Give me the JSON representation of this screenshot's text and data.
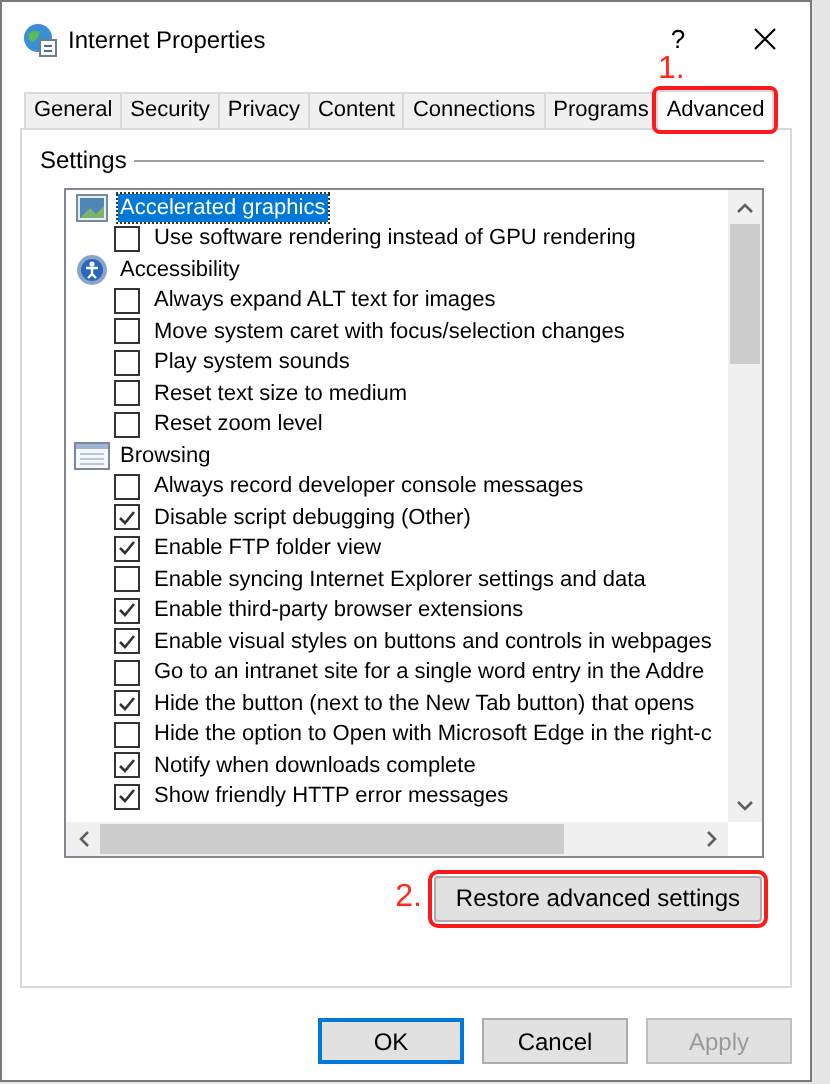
{
  "window": {
    "title": "Internet Properties",
    "help": "?"
  },
  "tabs": [
    {
      "label": "General",
      "selected": false
    },
    {
      "label": "Security",
      "selected": false
    },
    {
      "label": "Privacy",
      "selected": false
    },
    {
      "label": "Content",
      "selected": false
    },
    {
      "label": "Connections",
      "selected": false
    },
    {
      "label": "Programs",
      "selected": false
    },
    {
      "label": "Advanced",
      "selected": true,
      "step": "1."
    }
  ],
  "settings": {
    "title": "Settings",
    "tree": [
      {
        "label": "Accelerated graphics",
        "selected": true,
        "children": [
          {
            "label": "Use software rendering instead of GPU rendering",
            "checked": false,
            "selected": false
          }
        ]
      },
      {
        "label": "Accessibility",
        "selected": false,
        "children": [
          {
            "label": "Always expand ALT text for images",
            "checked": false,
            "selected": false
          },
          {
            "label": "Move system caret with focus/selection changes",
            "checked": false,
            "selected": false
          },
          {
            "label": "Play system sounds",
            "checked": false,
            "selected": false
          },
          {
            "label": "Reset text size to medium",
            "checked": false,
            "selected": false
          },
          {
            "label": "Reset zoom level",
            "checked": false,
            "selected": false
          }
        ]
      },
      {
        "label": "Browsing",
        "selected": false,
        "children": [
          {
            "label": "Always record developer console messages",
            "checked": false,
            "selected": false
          },
          {
            "label": "Disable script debugging (Other)",
            "checked": true,
            "selected": false
          },
          {
            "label": "Enable FTP folder view",
            "checked": true,
            "selected": false
          },
          {
            "label": "Enable syncing Internet Explorer settings and data",
            "checked": false,
            "selected": false
          },
          {
            "label": "Enable third-party browser extensions",
            "checked": true,
            "selected": false
          },
          {
            "label": "Enable visual styles on buttons and controls in webpages",
            "checked": true,
            "selected": false
          },
          {
            "label": "Go to an intranet site for a single word entry in the Addre",
            "checked": false,
            "selected": false
          },
          {
            "label": "Hide the button (next to the New Tab button) that opens",
            "checked": true,
            "selected": false
          },
          {
            "label": "Hide the option to Open with Microsoft Edge in the right-c",
            "checked": false,
            "selected": false
          },
          {
            "label": "Notify when downloads complete",
            "checked": true,
            "selected": false
          },
          {
            "label": "Show friendly HTTP error messages",
            "checked": true,
            "selected": false
          }
        ]
      }
    ]
  },
  "restore_button": {
    "label": "Restore advanced settings",
    "step": "2."
  },
  "buttons": [
    {
      "label": "OK",
      "default": true,
      "disabled": false
    },
    {
      "label": "Cancel",
      "default": false,
      "disabled": false
    },
    {
      "label": "Apply",
      "default": false,
      "disabled": true
    }
  ]
}
